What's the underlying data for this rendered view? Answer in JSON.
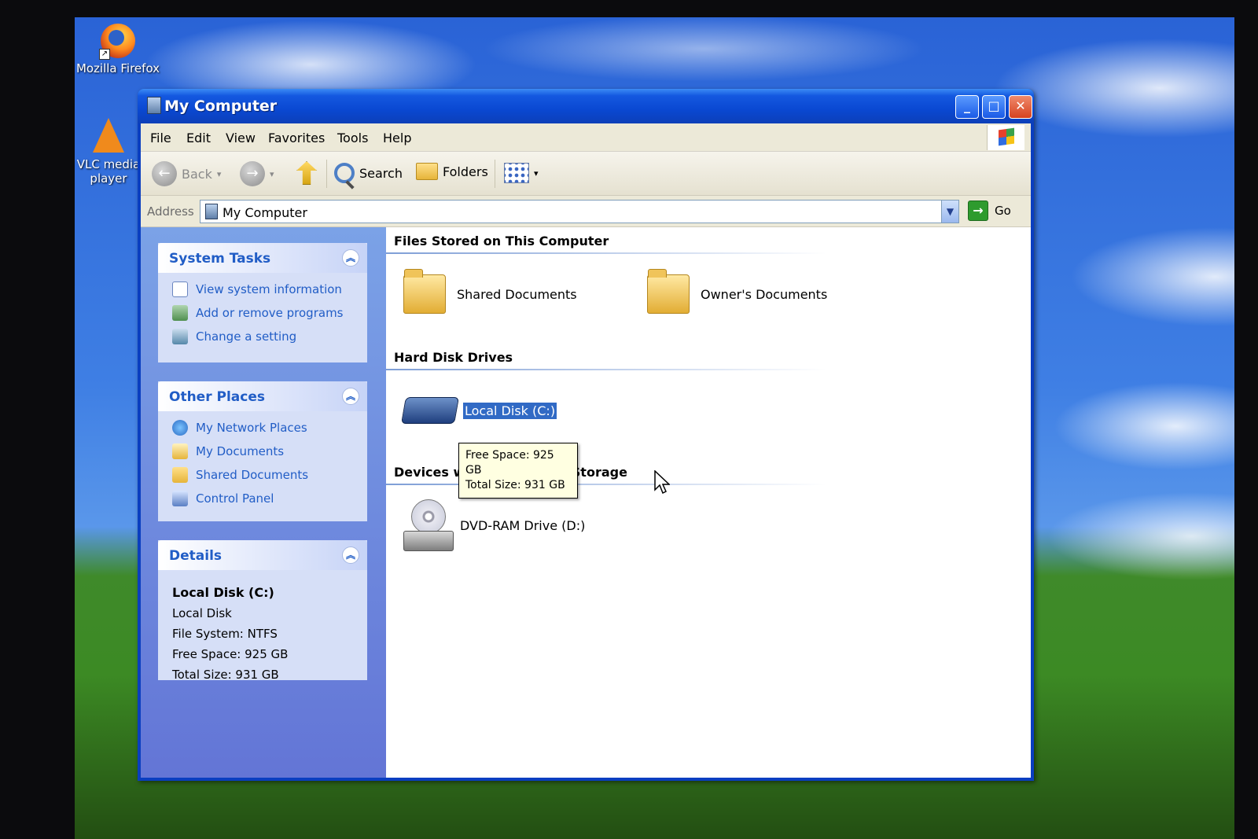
{
  "desktop": {
    "icons": [
      {
        "label": "Mozilla Firefox"
      },
      {
        "label": "VLC media player"
      }
    ]
  },
  "window": {
    "title": "My Computer",
    "controls": {
      "minimize": "_",
      "maximize": "□",
      "close": "✕"
    }
  },
  "menubar": {
    "items": [
      "File",
      "Edit",
      "View",
      "Favorites",
      "Tools",
      "Help"
    ]
  },
  "toolbar": {
    "back": "Back",
    "search": "Search",
    "folders": "Folders",
    "back_glyph": "←",
    "forward_glyph": "→",
    "dropdown_glyph": "▾"
  },
  "addressbar": {
    "label": "Address",
    "value": "My Computer",
    "go": "Go",
    "go_glyph": "→",
    "dropdown_glyph": "▼"
  },
  "task_pane": {
    "collapse_glyph": "︽",
    "system_tasks": {
      "title": "System Tasks",
      "links": [
        "View system information",
        "Add or remove programs",
        "Change a setting"
      ]
    },
    "other_places": {
      "title": "Other Places",
      "links": [
        "My Network Places",
        "My Documents",
        "Shared Documents",
        "Control Panel"
      ]
    },
    "details": {
      "title": "Details",
      "name": "Local Disk (C:)",
      "type": "Local Disk",
      "file_system": "File System: NTFS",
      "free_space": "Free Space: 925 GB",
      "total_size": "Total Size: 931 GB"
    }
  },
  "main": {
    "groups": {
      "files_stored": "Files Stored on This Computer",
      "hard_disk_drives": "Hard Disk Drives",
      "removable": "Devices with Removable Storage"
    },
    "items": {
      "shared_documents": "Shared Documents",
      "owners_documents": "Owner's Documents",
      "local_disk": "Local Disk (C:)",
      "dvd_drive": "DVD-RAM Drive (D:)"
    },
    "tooltip": {
      "free_space": "Free Space: 925 GB",
      "total_size": "Total Size: 931 GB"
    }
  },
  "colors": {
    "title_bar": "#0a48d2",
    "task_link": "#215dc6",
    "selection": "#316ac5",
    "tooltip_bg": "#ffffe1"
  }
}
